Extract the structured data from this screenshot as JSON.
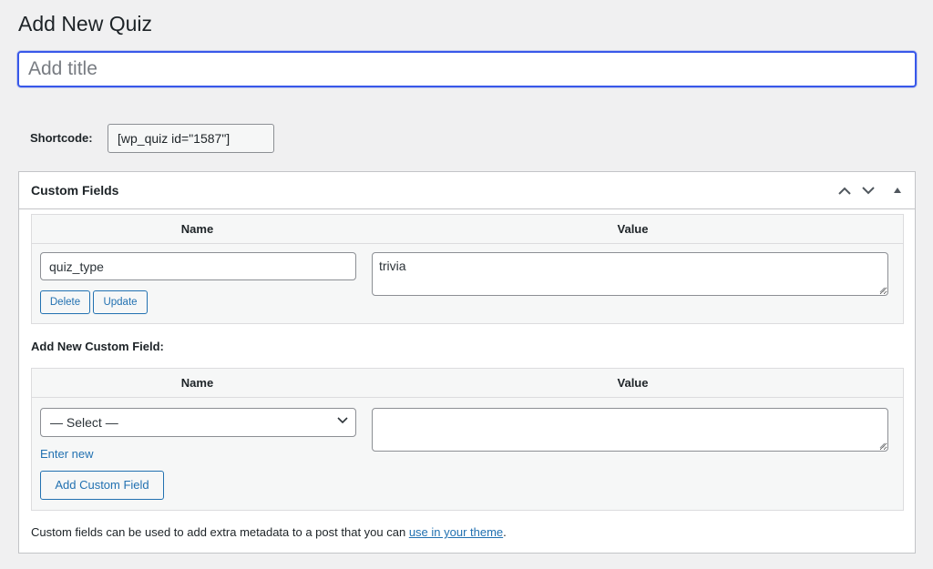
{
  "page": {
    "title": "Add New Quiz"
  },
  "title_field": {
    "placeholder": "Add title",
    "value": ""
  },
  "shortcode": {
    "label": "Shortcode:",
    "value": "[wp_quiz id=\"1587\"]"
  },
  "custom_fields": {
    "title": "Custom Fields",
    "header_icons": [
      "chevron-up-icon",
      "chevron-down-icon",
      "triangle-up-icon"
    ],
    "columns": [
      "Name",
      "Value"
    ],
    "rows": [
      {
        "name": "quiz_type",
        "value": "trivia",
        "delete_label": "Delete",
        "update_label": "Update"
      }
    ],
    "add_new": {
      "label": "Add New Custom Field:",
      "columns": [
        "Name",
        "Value"
      ],
      "select_value": "— Select —",
      "enter_new_label": "Enter new",
      "value": "",
      "add_button_label": "Add Custom Field"
    },
    "help": {
      "prefix": "Custom fields can be used to add extra metadata to a post that you can ",
      "link_text": "use in your theme",
      "suffix": "."
    }
  },
  "colors": {
    "accent": "#2271b1",
    "focus": "#3858e9",
    "background": "#f0f0f1",
    "text": "#1d2327"
  }
}
